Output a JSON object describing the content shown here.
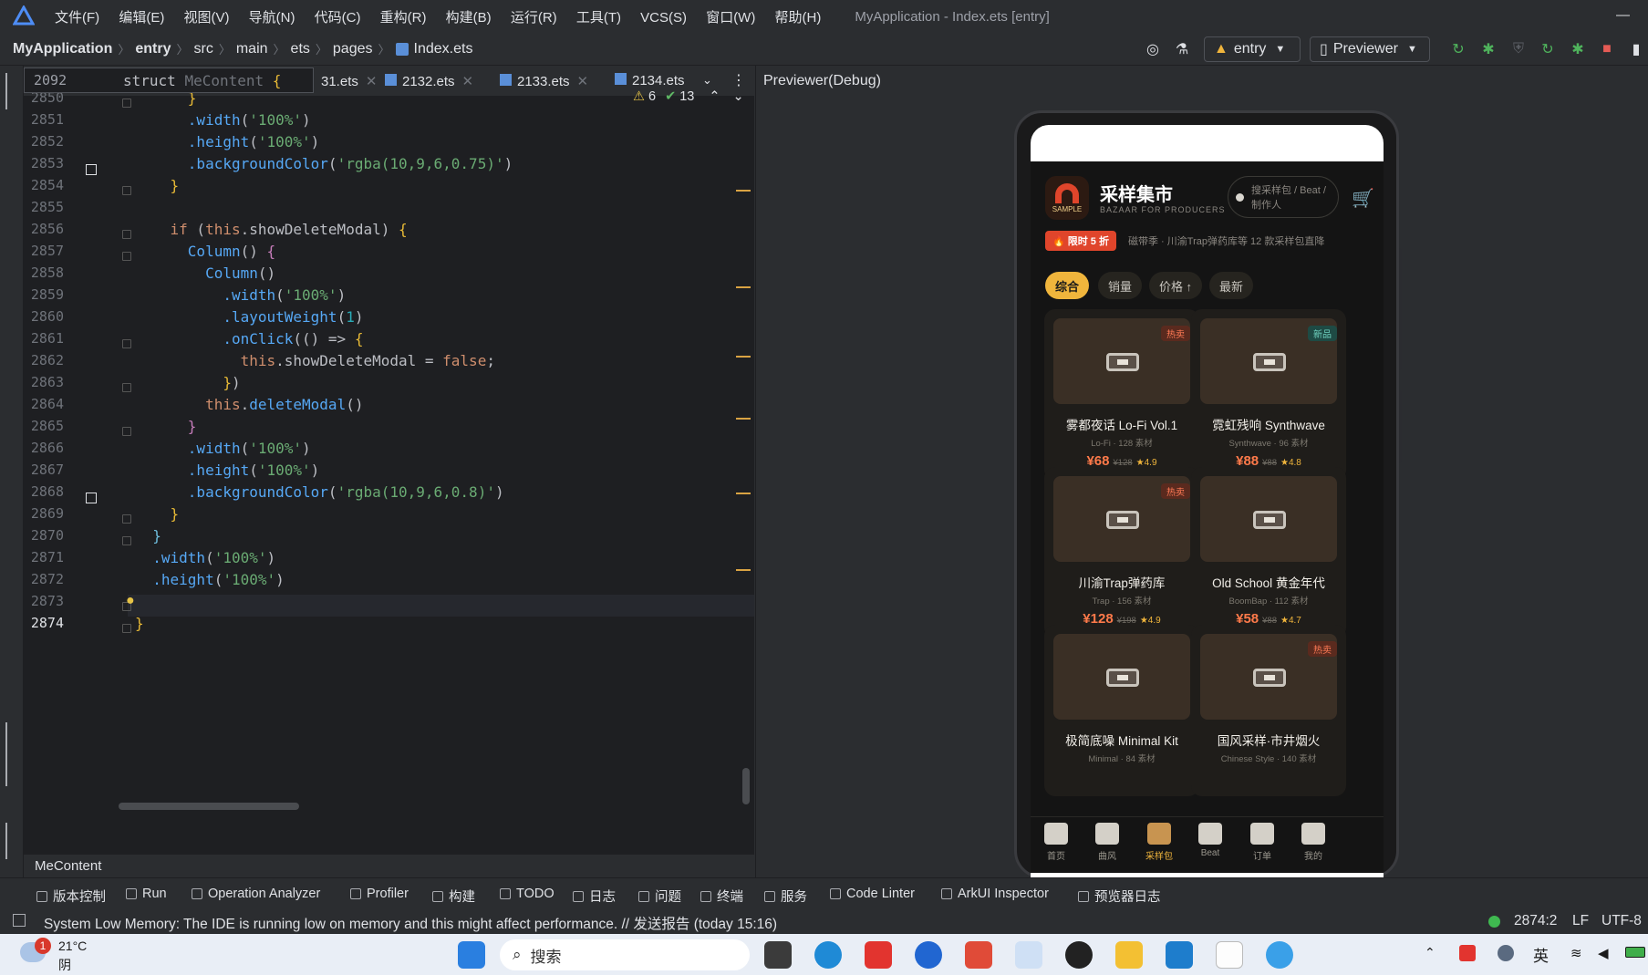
{
  "titlebar": {
    "menu": [
      "文件(F)",
      "编辑(E)",
      "视图(V)",
      "导航(N)",
      "代码(C)",
      "重构(R)",
      "构建(B)",
      "运行(R)",
      "工具(T)",
      "VCS(S)",
      "窗口(W)",
      "帮助(H)"
    ],
    "window_title": "MyApplication - Index.ets [entry]",
    "minimize": "—"
  },
  "navbar": {
    "breadcrumb": [
      "MyApplication",
      "entry",
      "src",
      "main",
      "ets",
      "pages",
      "Index.ets"
    ],
    "run_config": "entry",
    "device": "Previewer"
  },
  "editor": {
    "sticky_line_number": "2092",
    "sticky_code": [
      "struct",
      "MeContent",
      "{"
    ],
    "tabs": [
      "31.ets",
      "2132.ets",
      "2133.ets",
      "2134.ets"
    ],
    "warnings": "6",
    "checks": "13",
    "lines": [
      {
        "n": "2850",
        "code": "      }"
      },
      {
        "n": "2851",
        "code": "      .width('100%')"
      },
      {
        "n": "2852",
        "code": "      .height('100%')"
      },
      {
        "n": "2853",
        "code": "      .backgroundColor('rgba(10,9,6,0.75)')"
      },
      {
        "n": "2854",
        "code": "    }"
      },
      {
        "n": "2855",
        "code": ""
      },
      {
        "n": "2856",
        "code": "    if (this.showDeleteModal) {"
      },
      {
        "n": "2857",
        "code": "      Column() {"
      },
      {
        "n": "2858",
        "code": "        Column()"
      },
      {
        "n": "2859",
        "code": "          .width('100%')"
      },
      {
        "n": "2860",
        "code": "          .layoutWeight(1)"
      },
      {
        "n": "2861",
        "code": "          .onClick(() => {"
      },
      {
        "n": "2862",
        "code": "            this.showDeleteModal = false;"
      },
      {
        "n": "2863",
        "code": "          })"
      },
      {
        "n": "2864",
        "code": "        this.deleteModal()"
      },
      {
        "n": "2865",
        "code": "      }"
      },
      {
        "n": "2866",
        "code": "      .width('100%')"
      },
      {
        "n": "2867",
        "code": "      .height('100%')"
      },
      {
        "n": "2868",
        "code": "      .backgroundColor('rgba(10,9,6,0.8)')"
      },
      {
        "n": "2869",
        "code": "    }"
      },
      {
        "n": "2870",
        "code": "  }"
      },
      {
        "n": "2871",
        "code": "  .width('100%')"
      },
      {
        "n": "2872",
        "code": "  .height('100%')"
      },
      {
        "n": "2873",
        "code": ""
      },
      {
        "n": "2874",
        "code": "}"
      }
    ],
    "bottom_name": "MeContent"
  },
  "previewer": {
    "title": "Previewer(Debug)",
    "app": {
      "brand_text": "SAMPLE",
      "title": "采样集市",
      "subtitle": "BAZAAR FOR PRODUCERS",
      "search_placeholder": "搜采样包 / Beat / 制作人",
      "promo_badge": "🔥 限时 5 折",
      "promo_text": "磁带季 · 川渝Trap弹药库等 12 款采样包直降",
      "chips": [
        "综合",
        "销量",
        "价格 ↑",
        "最新"
      ],
      "cards": [
        {
          "name": "雾都夜话 Lo-Fi Vol.1",
          "meta": "Lo-Fi · 128 素材",
          "price": "¥68",
          "orig": "¥128",
          "rating": "★4.9",
          "badge": "热卖",
          "badge_type": "hot"
        },
        {
          "name": "霓虹残响 Synthwave",
          "meta": "Synthwave · 96 素材",
          "price": "¥88",
          "orig": "¥88",
          "rating": "★4.8",
          "badge": "新品",
          "badge_type": "new"
        },
        {
          "name": "川渝Trap弹药库",
          "meta": "Trap · 156 素材",
          "price": "¥128",
          "orig": "¥198",
          "rating": "★4.9",
          "badge": "热卖",
          "badge_type": "hot"
        },
        {
          "name": "Old School 黄金年代",
          "meta": "BoomBap · 112 素材",
          "price": "¥58",
          "orig": "¥88",
          "rating": "★4.7",
          "badge": "",
          "badge_type": ""
        },
        {
          "name": "极简底噪 Minimal Kit",
          "meta": "Minimal · 84 素材",
          "price": "",
          "orig": "",
          "rating": "",
          "badge": "",
          "badge_type": ""
        },
        {
          "name": "国风采样·市井烟火",
          "meta": "Chinese Style · 140 素材",
          "price": "",
          "orig": "",
          "rating": "",
          "badge": "热卖",
          "badge_type": "hot"
        }
      ],
      "tabs": [
        "首页",
        "曲风",
        "采样包",
        "Beat",
        "订单",
        "我的"
      ]
    }
  },
  "tools": [
    "版本控制",
    "Run",
    "Operation Analyzer",
    "Profiler",
    "构建",
    "TODO",
    "日志",
    "问题",
    "终端",
    "服务",
    "Code Linter",
    "ArkUI Inspector",
    "预览器日志"
  ],
  "status": {
    "message": "System Low Memory: The IDE is running low on memory and this might affect performance. // 发送报告 (today 15:16)",
    "position": "2874:2",
    "line_sep": "LF",
    "encoding": "UTF-8"
  },
  "taskbar": {
    "weather_temp": "21°C",
    "weather_desc": "阴",
    "notif_count": "1",
    "search": "搜索",
    "ime": "英"
  },
  "colors": {
    "accent": "#f0b53c",
    "promo": "#e0452b",
    "editor_bg": "#1e1f22"
  }
}
